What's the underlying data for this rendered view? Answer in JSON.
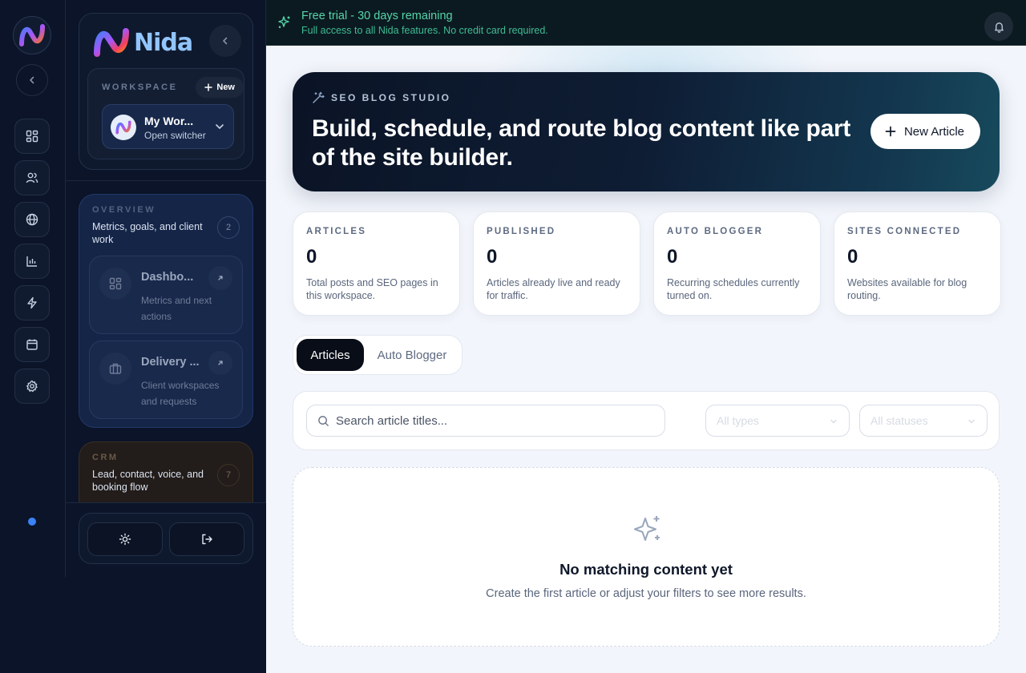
{
  "brand": {
    "name": "Nida"
  },
  "workspace": {
    "label": "WORKSPACE",
    "new_label": "New",
    "name": "My Wor...",
    "switcher_label": "Open switcher"
  },
  "sidebar": {
    "sections": [
      {
        "tag": "OVERVIEW",
        "description": "Metrics, goals, and client work",
        "count": "2",
        "items": [
          {
            "title": "Dashbo...",
            "subtitle": "Metrics and next actions",
            "icon": "dashboard-icon"
          },
          {
            "title": "Delivery ...",
            "subtitle": "Client workspaces and requests",
            "icon": "briefcase-icon"
          }
        ]
      },
      {
        "tag": "CRM",
        "description": "Lead, contact, voice, and booking flow",
        "count": "7"
      }
    ]
  },
  "rail": {
    "icons": [
      "dashboard-icon",
      "users-icon",
      "globe-icon",
      "chart-icon",
      "bolt-icon",
      "calendar-icon",
      "settings-icon"
    ]
  },
  "banner": {
    "title": "Free trial - 30 days remaining",
    "subtitle": "Full access to all Nida features. No credit card required."
  },
  "hero": {
    "tag": "SEO BLOG STUDIO",
    "title": "Build, schedule, and route blog content like part of the site builder.",
    "cta_label": "New Article"
  },
  "stats": [
    {
      "label": "ARTICLES",
      "value": "0",
      "description": "Total posts and SEO pages in this workspace."
    },
    {
      "label": "PUBLISHED",
      "value": "0",
      "description": "Articles already live and ready for traffic."
    },
    {
      "label": "AUTO BLOGGER",
      "value": "0",
      "description": "Recurring schedules currently turned on."
    },
    {
      "label": "SITES CONNECTED",
      "value": "0",
      "description": "Websites available for blog routing."
    }
  ],
  "tabs": [
    {
      "label": "Articles",
      "active": true
    },
    {
      "label": "Auto Blogger",
      "active": false
    }
  ],
  "filters": {
    "search_placeholder": "Search article titles...",
    "type_selected": "All types",
    "status_selected": "All statuses"
  },
  "empty_state": {
    "title": "No matching content yet",
    "subtitle": "Create the first article or adjust your filters to see more results."
  },
  "colors": {
    "accent": "#3b82f6",
    "banner_text": "#56d6a8",
    "page_bg": "#f2f5fb",
    "sidebar_bg": "#0b1428"
  }
}
